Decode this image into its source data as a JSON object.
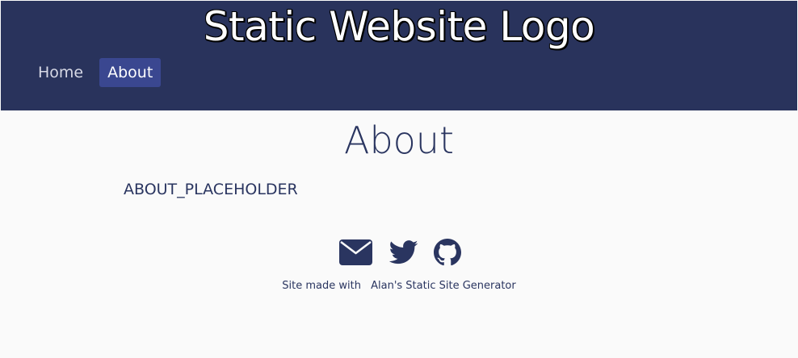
{
  "header": {
    "logo_text": "Static Website Logo",
    "nav": [
      {
        "label": "Home",
        "active": false
      },
      {
        "label": "About",
        "active": true
      }
    ]
  },
  "main": {
    "title": "About",
    "content": "ABOUT_PLACEHOLDER"
  },
  "footer": {
    "social_icons": [
      "envelope-icon",
      "twitter-icon",
      "github-icon"
    ],
    "made_with": "Site made with",
    "generator_link": "Alan's Static Site Generator"
  },
  "colors": {
    "header_bg": "#29335c",
    "nav_active_bg": "#3a4790",
    "text": "#2a3560",
    "page_bg": "#fafafa"
  }
}
